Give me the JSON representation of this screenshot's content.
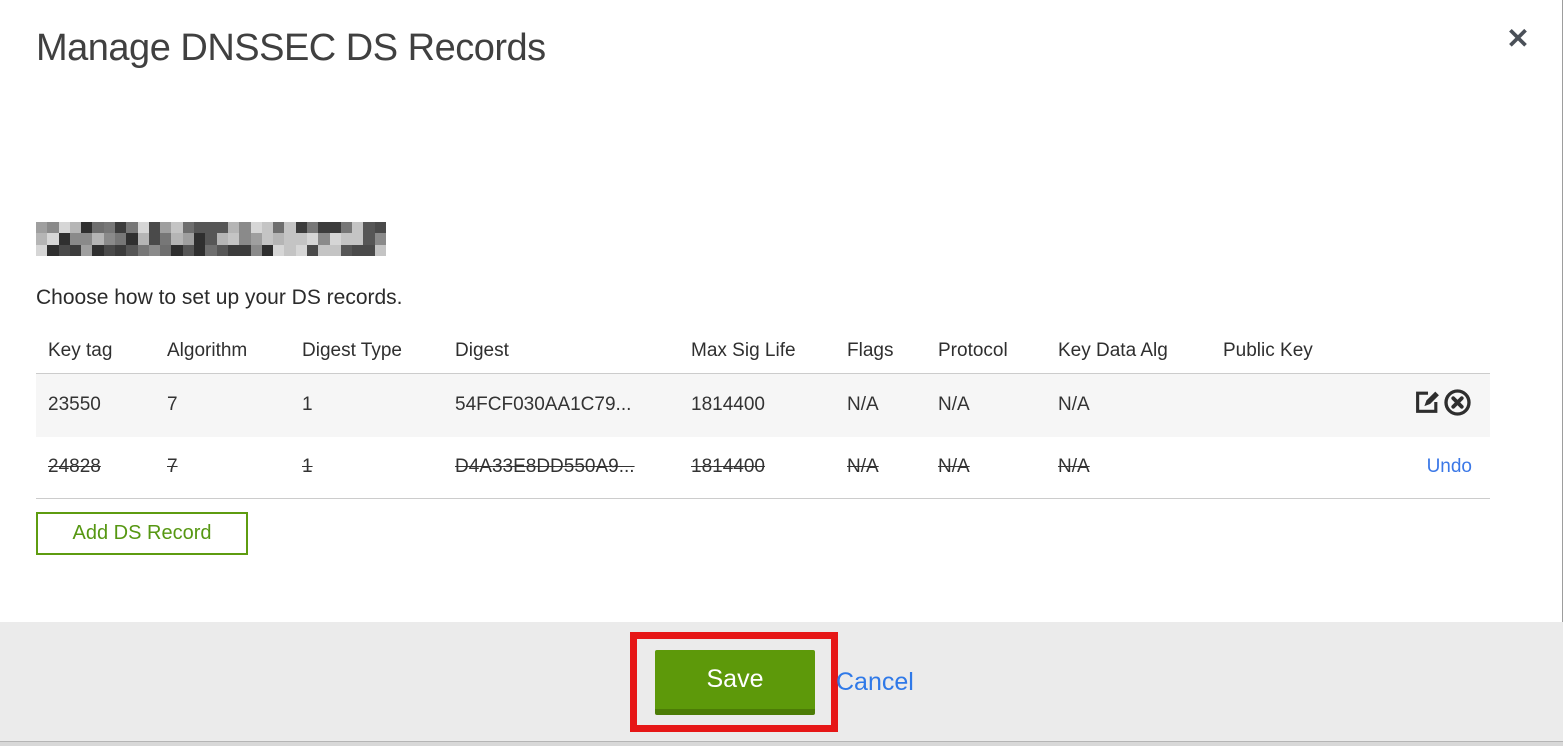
{
  "dialog": {
    "title": "Manage DNSSEC DS Records",
    "close_icon": "✕",
    "instruction": "Choose how to set up your DS records."
  },
  "table": {
    "columns": {
      "key_tag": "Key tag",
      "algorithm": "Algorithm",
      "digest_type": "Digest Type",
      "digest": "Digest",
      "max_sig_life": "Max Sig Life",
      "flags": "Flags",
      "protocol": "Protocol",
      "key_data_alg": "Key Data Alg",
      "public_key": "Public Key"
    },
    "rows": [
      {
        "key_tag": "23550",
        "algorithm": "7",
        "digest_type": "1",
        "digest": "54FCF030AA1C79...",
        "max_sig_life": "1814400",
        "flags": "N/A",
        "protocol": "N/A",
        "key_data_alg": "N/A",
        "public_key": "",
        "state": "normal"
      },
      {
        "key_tag": "24828",
        "algorithm": "7",
        "digest_type": "1",
        "digest": "D4A33E8DD550A9...",
        "max_sig_life": "1814400",
        "flags": "N/A",
        "protocol": "N/A",
        "key_data_alg": "N/A",
        "public_key": "",
        "state": "deleted",
        "undo_label": "Undo"
      }
    ]
  },
  "buttons": {
    "add_ds_record": "Add DS Record",
    "save": "Save",
    "cancel": "Cancel"
  },
  "colors": {
    "green_button": "#5d990a",
    "green_button_shadow": "#4c7c06",
    "green_outline": "#5e9c10",
    "link_blue": "#2f79e8",
    "annotation_red": "#e61717",
    "footer_bg": "#ebebeb",
    "row_stripe": "#f6f6f6"
  },
  "redaction": {
    "rows": 3,
    "cols": 31,
    "seed": 73,
    "palette": [
      "#8a8a8a",
      "#4a4a4a",
      "#b5b5b5",
      "#2f2f2f",
      "#6e6e6e",
      "#d6d6d6",
      "#3c3c3c",
      "#9f9f9f",
      "#565656",
      "#c4c4c4",
      "#777777",
      "#303030"
    ]
  }
}
